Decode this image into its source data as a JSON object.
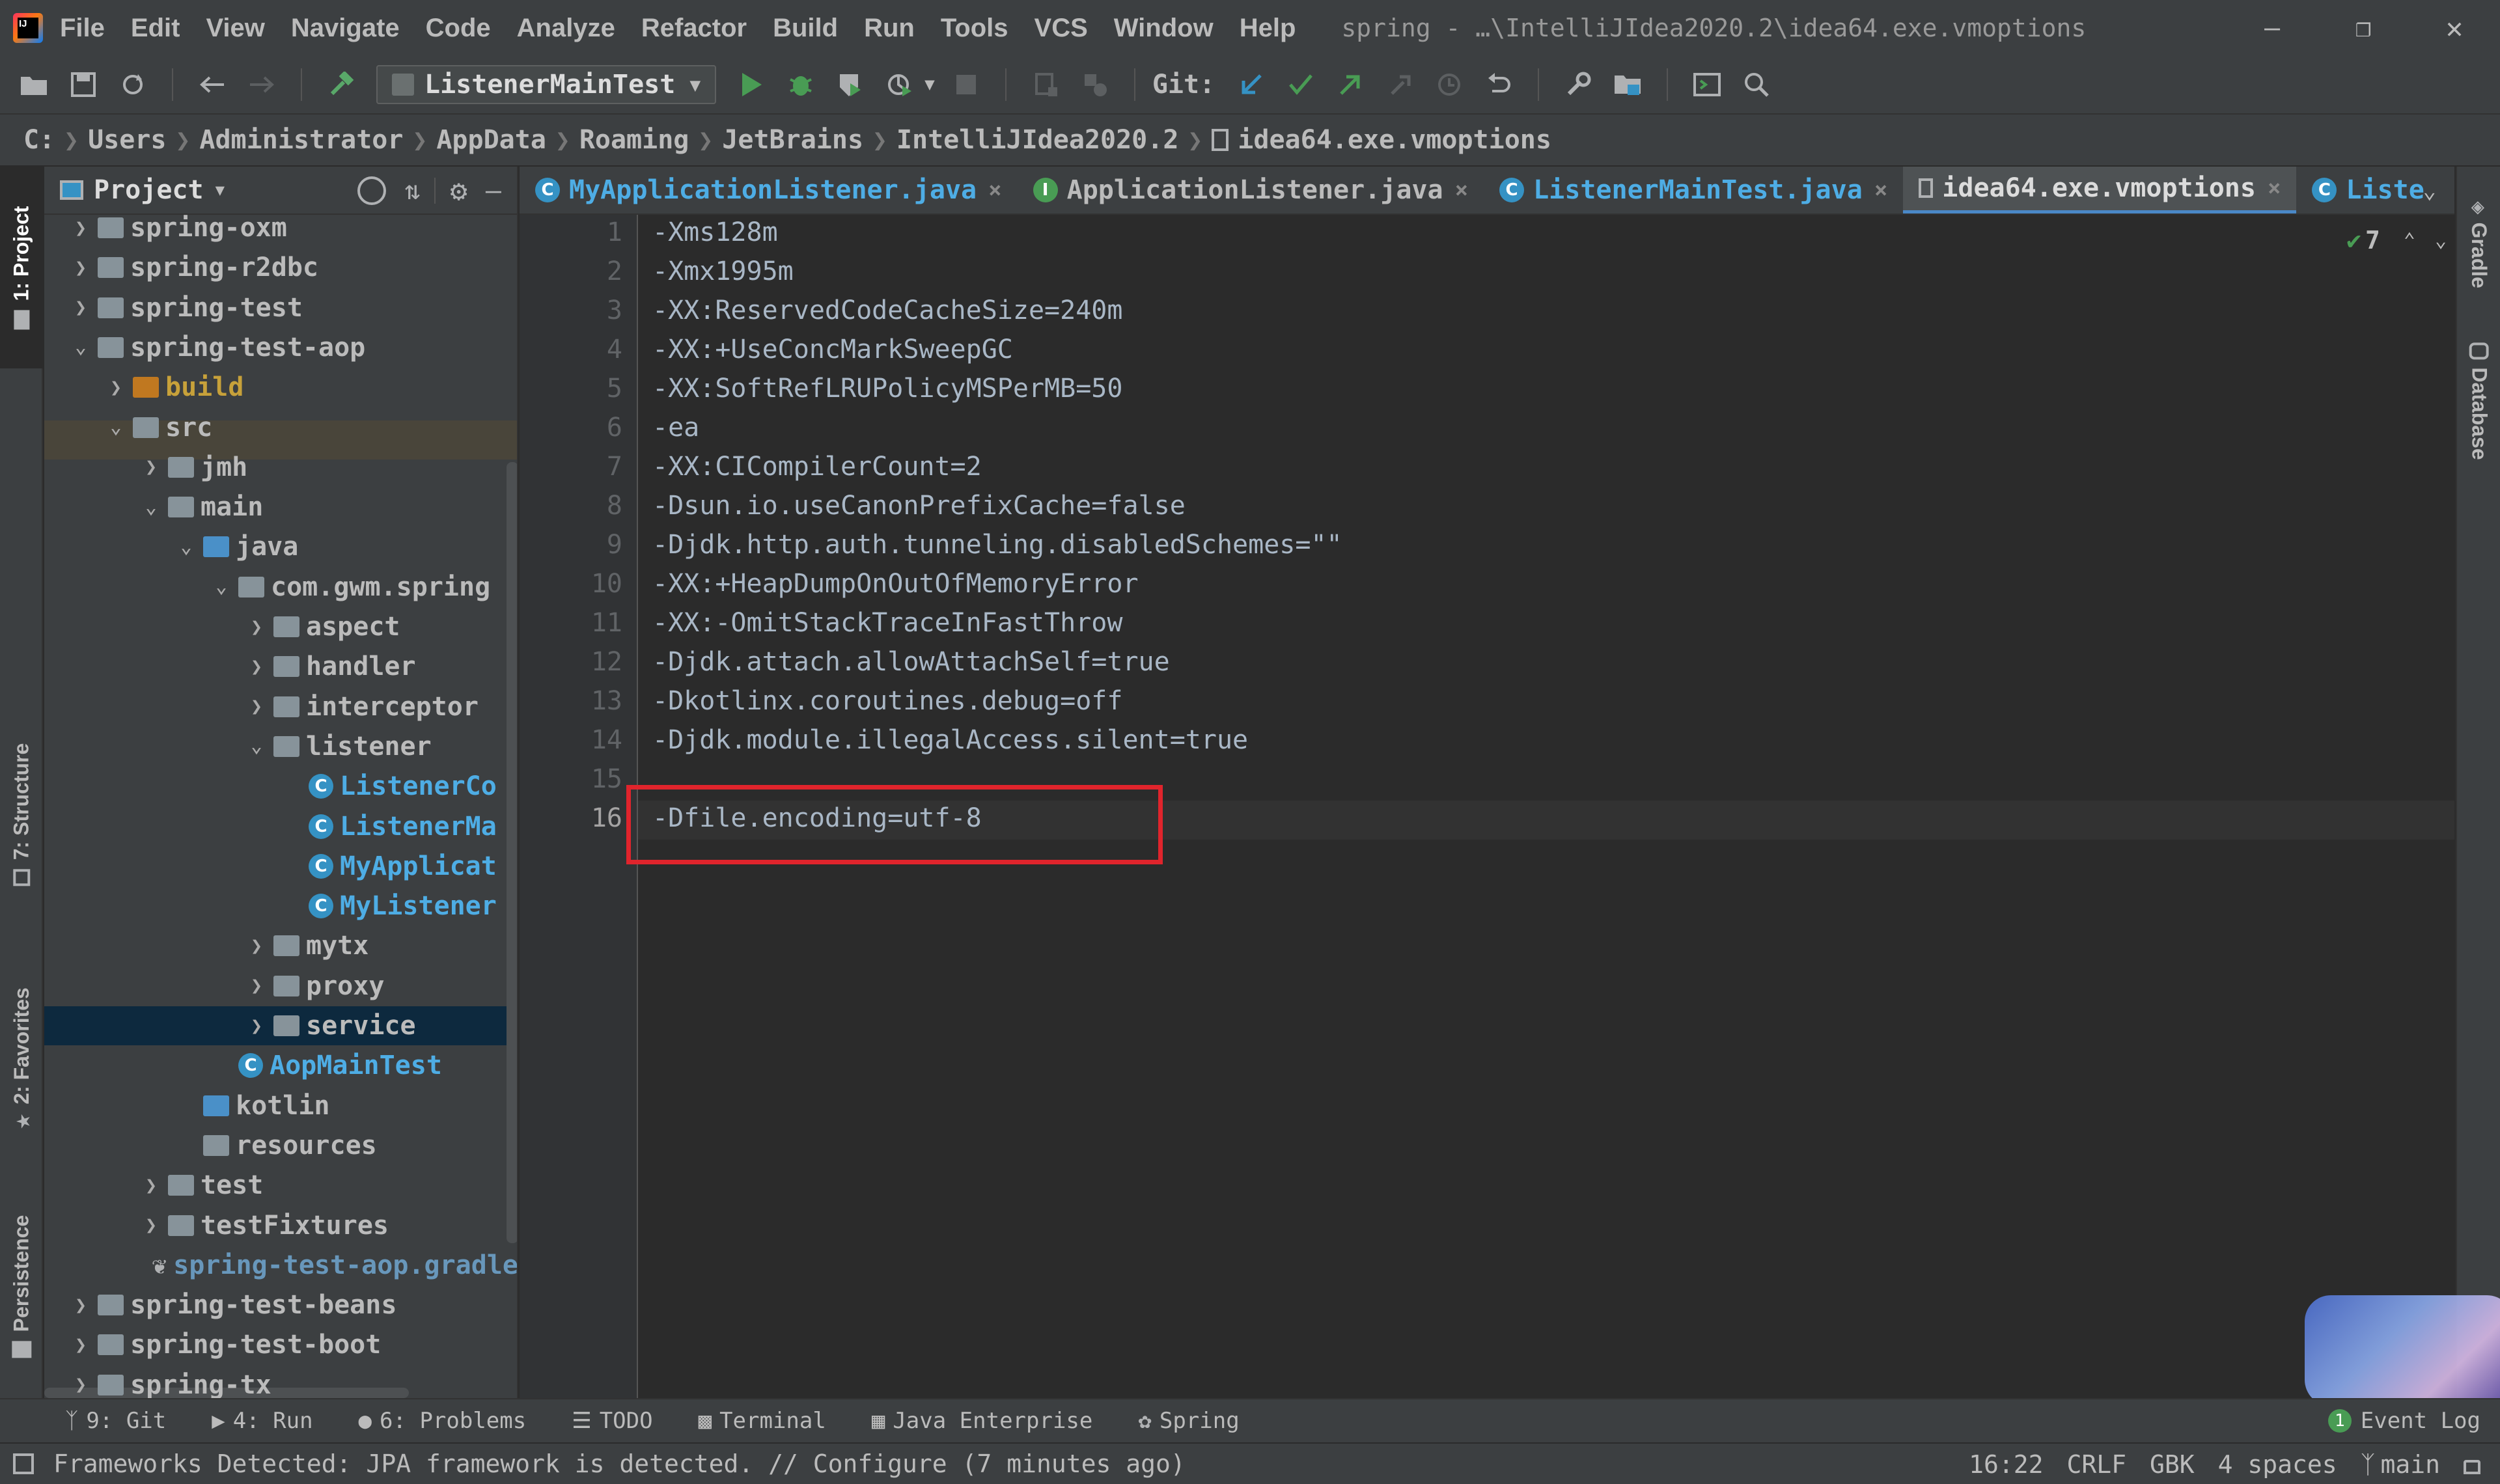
{
  "window": {
    "title": "spring - …\\IntelliJIdea2020.2\\idea64.exe.vmoptions",
    "app_logo": "IJ"
  },
  "menu": [
    "File",
    "Edit",
    "View",
    "Navigate",
    "Code",
    "Analyze",
    "Refactor",
    "Build",
    "Run",
    "Tools",
    "VCS",
    "Window",
    "Help"
  ],
  "toolbar": {
    "run_config": "ListenerMainTest",
    "git_label": "Git:"
  },
  "breadcrumb": [
    "C:",
    "Users",
    "Administrator",
    "AppData",
    "Roaming",
    "JetBrains",
    "IntelliJIdea2020.2",
    "idea64.exe.vmoptions"
  ],
  "project_panel": {
    "title": "Project",
    "tree": [
      {
        "label": "spring-oxm",
        "state": "collapsed",
        "icon": "module-folder"
      },
      {
        "label": "spring-r2dbc",
        "state": "collapsed",
        "icon": "module-folder"
      },
      {
        "label": "spring-test",
        "state": "collapsed",
        "icon": "module-folder"
      },
      {
        "label": "spring-test-aop",
        "state": "expanded",
        "icon": "module-folder"
      },
      {
        "label": "build",
        "state": "collapsed",
        "icon": "excluded-folder"
      },
      {
        "label": "src",
        "state": "expanded",
        "icon": "folder"
      },
      {
        "label": "jmh",
        "state": "collapsed",
        "icon": "module-folder"
      },
      {
        "label": "main",
        "state": "expanded",
        "icon": "module-folder"
      },
      {
        "label": "java",
        "state": "expanded",
        "icon": "source-folder"
      },
      {
        "label": "com.gwm.spring",
        "state": "expanded",
        "icon": "package"
      },
      {
        "label": "aspect",
        "state": "collapsed",
        "icon": "package"
      },
      {
        "label": "handler",
        "state": "collapsed",
        "icon": "package"
      },
      {
        "label": "interceptor",
        "state": "collapsed",
        "icon": "package"
      },
      {
        "label": "listener",
        "state": "expanded",
        "icon": "package"
      },
      {
        "label": "ListenerCo",
        "state": "leaf",
        "icon": "class"
      },
      {
        "label": "ListenerMa",
        "state": "leaf",
        "icon": "runnable-class"
      },
      {
        "label": "MyApplicat",
        "state": "leaf",
        "icon": "class"
      },
      {
        "label": "MyListener",
        "state": "leaf",
        "icon": "class"
      },
      {
        "label": "mytx",
        "state": "collapsed",
        "icon": "package"
      },
      {
        "label": "proxy",
        "state": "collapsed",
        "icon": "package"
      },
      {
        "label": "service",
        "state": "collapsed",
        "icon": "package"
      },
      {
        "label": "AopMainTest",
        "state": "leaf",
        "icon": "runnable-class"
      },
      {
        "label": "kotlin",
        "state": "leaf",
        "icon": "source-folder"
      },
      {
        "label": "resources",
        "state": "leaf",
        "icon": "resources-folder"
      },
      {
        "label": "test",
        "state": "collapsed",
        "icon": "module-folder"
      },
      {
        "label": "testFixtures",
        "state": "collapsed",
        "icon": "module-folder"
      },
      {
        "label": "spring-test-aop.gradle",
        "state": "leaf",
        "icon": "gradle-file"
      },
      {
        "label": "spring-test-beans",
        "state": "collapsed",
        "icon": "module-folder"
      },
      {
        "label": "spring-test-boot",
        "state": "collapsed",
        "icon": "module-folder"
      },
      {
        "label": "spring-tx",
        "state": "collapsed",
        "icon": "module-folder"
      }
    ]
  },
  "editor_tabs": [
    {
      "label": "MyApplicationListener.java",
      "active": false,
      "icon": "class"
    },
    {
      "label": "ApplicationListener.java",
      "active": false,
      "icon": "interface"
    },
    {
      "label": "ListenerMainTest.java",
      "active": false,
      "icon": "runnable-class"
    },
    {
      "label": "idea64.exe.vmoptions",
      "active": true,
      "icon": "file"
    },
    {
      "label": "Liste",
      "active": false,
      "icon": "class"
    }
  ],
  "inspection_count": "7",
  "code_lines": [
    "-Xms128m",
    "-Xmx1995m",
    "-XX:ReservedCodeCacheSize=240m",
    "-XX:+UseConcMarkSweepGC",
    "-XX:SoftRefLRUPolicyMSPerMB=50",
    "-ea",
    "-XX:CICompilerCount=2",
    "-Dsun.io.useCanonPrefixCache=false",
    "-Djdk.http.auth.tunneling.disabledSchemes=\"\"",
    "-XX:+HeapDumpOnOutOfMemoryError",
    "-XX:-OmitStackTraceInFastThrow",
    "-Djdk.attach.allowAttachSelf=true",
    "-Dkotlinx.coroutines.debug=off",
    "-Djdk.module.illegalAccess.silent=true",
    "",
    "-Dfile.encoding=utf-8"
  ],
  "line_numbers": [
    "1",
    "2",
    "3",
    "4",
    "5",
    "6",
    "7",
    "8",
    "9",
    "10",
    "11",
    "12",
    "13",
    "14",
    "15",
    "16"
  ],
  "left_tool_windows": [
    "1: Project",
    "7: Structure",
    "2: Favorites",
    "Persistence"
  ],
  "right_tool_windows": [
    "Gradle",
    "Database"
  ],
  "bottom_tool_windows": [
    "9: Git",
    "4: Run",
    "6: Problems",
    "TODO",
    "Terminal",
    "Java Enterprise",
    "Spring"
  ],
  "event_log": {
    "count": "1",
    "label": "Event Log"
  },
  "status": {
    "message": "Frameworks Detected: JPA framework is detected. // Configure (7 minutes ago)",
    "position": "16:22",
    "line_sep": "CRLF",
    "encoding": "GBK",
    "indent": "4 spaces",
    "branch": "main"
  },
  "colors": {
    "highlight_box": "#e0242c",
    "selection": "#0d293e",
    "class_text": "#4eade5",
    "build_text": "#c7a13a",
    "gradle_text": "#6897bb"
  }
}
